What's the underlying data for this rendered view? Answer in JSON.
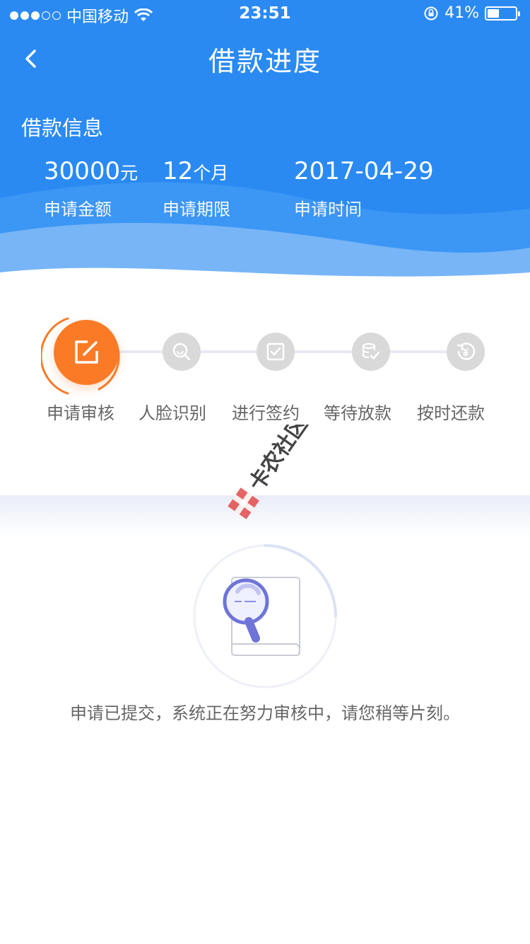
{
  "status_bar": {
    "carrier": "中国移动",
    "time": "23:51",
    "battery": "41%",
    "battery_level": 0.41
  },
  "nav": {
    "title": "借款进度",
    "back_icon": "chevron-left-icon"
  },
  "loan_info": {
    "section_title": "借款信息",
    "amount_value": "30000",
    "amount_unit": "元",
    "amount_label": "申请金额",
    "term_value": "12",
    "term_unit": "个月",
    "term_label": "申请期限",
    "date_value": "2017-04-29",
    "date_label": "申请时间"
  },
  "steps": [
    {
      "label": "申请审核",
      "icon": "edit-icon",
      "active": true
    },
    {
      "label": "人脸识别",
      "icon": "face-scan-icon",
      "active": false
    },
    {
      "label": "进行签约",
      "icon": "sign-check-icon",
      "active": false
    },
    {
      "label": "等待放款",
      "icon": "coins-check-icon",
      "active": false
    },
    {
      "label": "按时还款",
      "icon": "repay-icon",
      "active": false
    }
  ],
  "status_message": "申请已提交，系统正在努力审核中，请您稍等片刻。",
  "watermark": {
    "text": "卡农社区"
  },
  "colors": {
    "header_blue": "#2a8af2",
    "active_orange": "#fa7a26",
    "inactive_gray": "#d9d9d9",
    "label_gray": "#666666"
  }
}
